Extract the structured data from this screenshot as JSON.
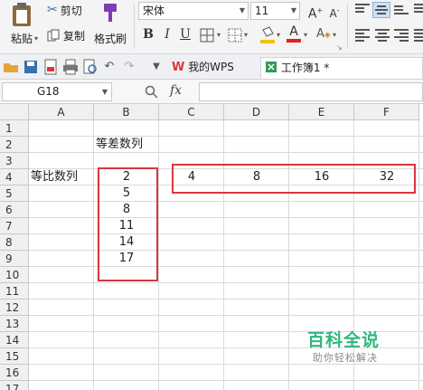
{
  "ribbon": {
    "paste_label": "粘贴",
    "cut_label": "剪切",
    "copy_label": "复制",
    "format_painter_label": "格式刷",
    "font_name": "宋体",
    "font_size": "11"
  },
  "tabs": {
    "wps_label": "我的WPS",
    "workbook_label": "工作簿1 *"
  },
  "formula_bar": {
    "cell_ref": "G18",
    "fx_label": "fx",
    "formula": ""
  },
  "sheet": {
    "columns": [
      "A",
      "B",
      "C",
      "D",
      "E",
      "F"
    ],
    "rows": [
      "1",
      "2",
      "3",
      "4",
      "5",
      "6",
      "7",
      "8",
      "9",
      "10",
      "11",
      "12",
      "13",
      "14",
      "15",
      "16",
      "17"
    ],
    "b2_label": "等差数列",
    "a4_label": "等比数列",
    "arithmetic_values": [
      "2",
      "5",
      "8",
      "11",
      "14",
      "17"
    ],
    "geometric_values": [
      "4",
      "8",
      "16",
      "32"
    ]
  },
  "watermark": {
    "title": "百科全说",
    "subtitle": "助你轻松解决"
  },
  "colors": {
    "highlight_border": "#d9363e",
    "watermark_green": "#31b77a",
    "fill_bucket_yellow": "#f2c200",
    "font_color_red": "#e02020"
  }
}
